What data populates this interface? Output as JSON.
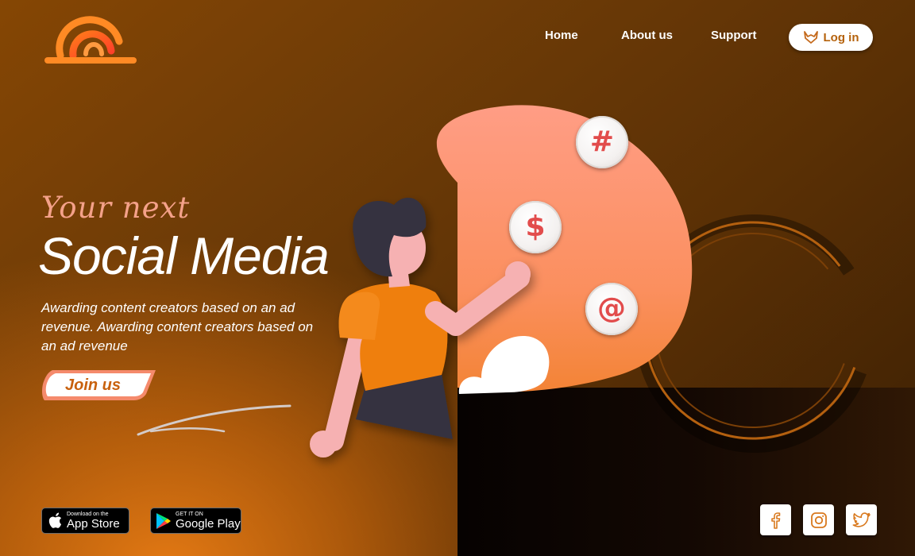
{
  "nav": {
    "items": [
      {
        "label": "Home"
      },
      {
        "label": "About us"
      },
      {
        "label": "Support"
      }
    ],
    "login_label": "Log in"
  },
  "hero": {
    "tagline": "Your next",
    "headline": "Social Media",
    "description": "Awarding content creators based on an ad revenue. Awarding content creators based on an ad revenue",
    "cta_label": "Join us"
  },
  "badges": {
    "app_store": {
      "small": "Download on the",
      "big": "App Store"
    },
    "google_play": {
      "small": "GET IT ON",
      "big": "Google Play"
    }
  },
  "bubbles": {
    "hash": "#",
    "dollar": "$",
    "at": "@"
  },
  "icons": {
    "logo": "sunrise-logo-icon",
    "login": "fox-icon",
    "apple": "apple-icon",
    "play": "google-play-icon",
    "facebook": "facebook-icon",
    "instagram": "instagram-icon",
    "twitter": "twitter-icon"
  },
  "colors": {
    "accent_orange": "#e0790f",
    "peach": "#f4a189",
    "bubble_symbol": "#e24c4c",
    "login_text": "#b5620c"
  }
}
